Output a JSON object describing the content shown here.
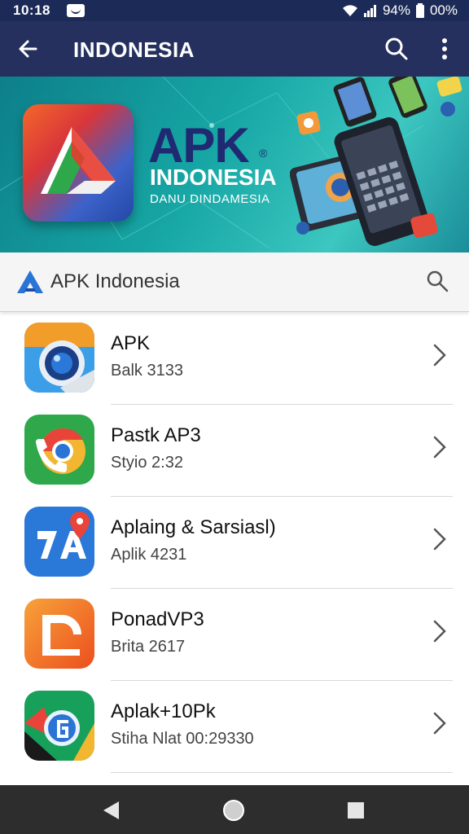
{
  "status_bar": {
    "time": "10:18",
    "battery_left": "94%",
    "battery_right": "00%"
  },
  "app_bar": {
    "title": "INDONESIA"
  },
  "banner": {
    "brand": "APK",
    "brand_mark": "®",
    "name": "INDONESIA",
    "subtitle": "DANU DINDAMESIA"
  },
  "search_bar": {
    "label": "APK Indonesia"
  },
  "apps": [
    {
      "name": "APK",
      "subtitle": "Balk 3133",
      "icon": "camera-lens-icon"
    },
    {
      "name": "Pastk AP3",
      "subtitle": "Styio 2:32",
      "icon": "chrome-phone-icon"
    },
    {
      "name": "Aplaing & Sarsiasl)",
      "subtitle": "Aplik 4231",
      "icon": "translate-pin-icon"
    },
    {
      "name": "PonadVP3",
      "subtitle": "Brita 2617",
      "icon": "orange-d-icon"
    },
    {
      "name": "Aplak+10Pk",
      "subtitle": "Stiha Nlat 00:29330",
      "icon": "green-g-icon"
    }
  ],
  "colors": {
    "status_bg": "#1c2a57",
    "app_bar_bg": "#25305f",
    "banner_teal": "#17a7a5",
    "brand_navy": "#1f2a72",
    "accent_blue": "#2a74d6",
    "nav_bar_bg": "#2d2d2d"
  }
}
